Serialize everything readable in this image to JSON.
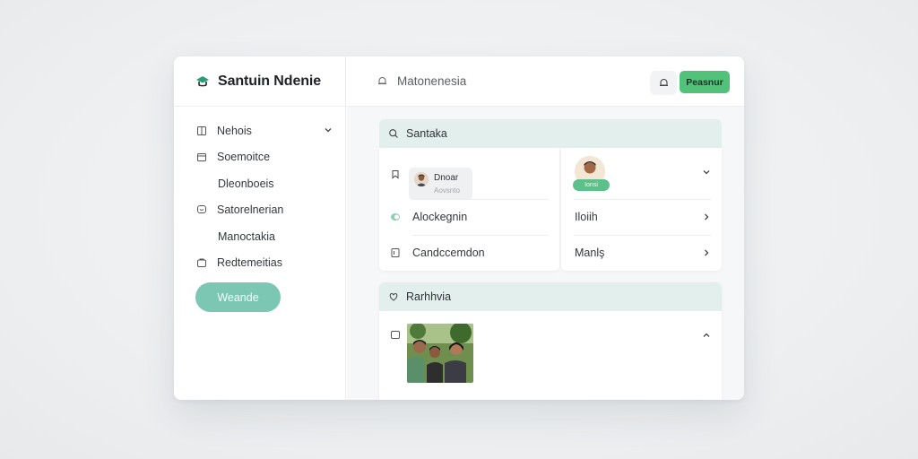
{
  "app": {
    "title": "Santuin Ndenie"
  },
  "sidebar": {
    "items": [
      {
        "label": "Nehois",
        "icon": "book-icon",
        "has_chevron": true
      },
      {
        "label": "Soemoitce",
        "icon": "folder-icon"
      },
      {
        "label": "Dleonboeis",
        "sub": true
      },
      {
        "label": "Satorelnerian",
        "icon": "chat-icon"
      },
      {
        "label": "Manoctakia",
        "sub": true
      },
      {
        "label": "Redtemeitias",
        "icon": "bag-icon"
      }
    ],
    "cta_label": "Weande"
  },
  "topbar": {
    "title": "Matonenesia",
    "primary_label": "Peasnur"
  },
  "panel1": {
    "header": "Santaka",
    "chip": {
      "name": "Dnoar",
      "sub": "Aovsnto"
    },
    "left_rows": [
      "Alockegnin",
      "Candccemdon"
    ],
    "badge": "Ionsi",
    "right_rows": [
      "Iloiih",
      "Manlş"
    ]
  },
  "panel2": {
    "header": "Rarhhvia"
  },
  "colors": {
    "accent_green": "#52c27b",
    "teal_button": "#7cc7b3",
    "panel_header": "#e3efec"
  }
}
